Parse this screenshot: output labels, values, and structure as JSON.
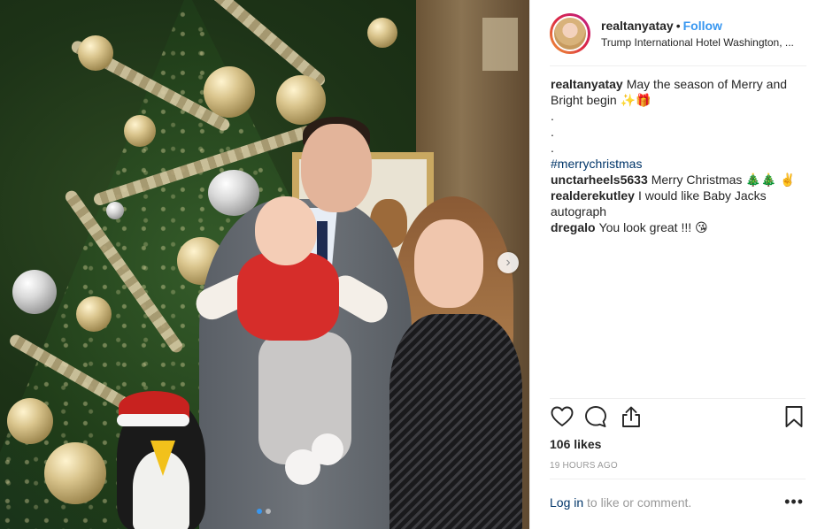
{
  "post": {
    "username": "realtanyatay",
    "separator": "•",
    "follow_label": "Follow",
    "location": "Trump International Hotel Washington, ...",
    "caption_text": "May the season of Merry and Bright begin ✨🎁",
    "caption_dots": [
      ".",
      ".",
      "."
    ],
    "hashtag": "#merrychristmas",
    "comments": [
      {
        "user": "unctarheels5633",
        "text": "Merry Christmas 🎄🎄 ✌️"
      },
      {
        "user": "realderekutley",
        "text": "I would like Baby Jacks autograph"
      },
      {
        "user": "dregalo",
        "text": "You look great !!! 😘"
      }
    ],
    "likes": "106 likes",
    "timestamp": "19 HOURS AGO",
    "login_link": "Log in",
    "login_suffix": " to like or comment.",
    "more_label": "•••"
  },
  "carousel": {
    "total": 2,
    "active": 1
  },
  "icons": {
    "like": "heart-icon",
    "comment": "comment-icon",
    "share": "share-icon",
    "save": "bookmark-icon",
    "next": "chevron-right-icon"
  },
  "colors": {
    "link": "#3897f0",
    "hashtag": "#003569",
    "muted": "#999999",
    "text": "#262626"
  }
}
